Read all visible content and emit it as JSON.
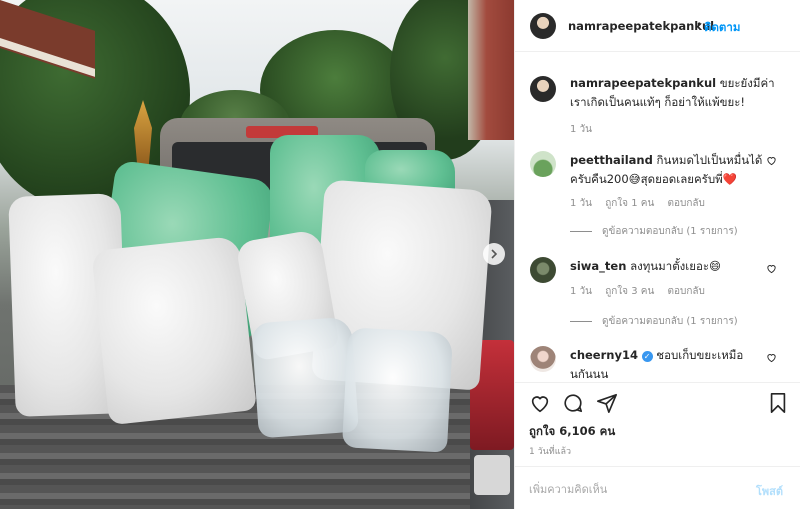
{
  "post": {
    "username": "namrapeepatekpankul",
    "follow_label": "ติดตาม",
    "separator": "•",
    "caption": "ขยะยังมีค่า เราเกิดเป็นคนแท้ๆ ก็อย่าให้แพ้ขยะ!",
    "caption_time": "1 วัน",
    "likes": "ถูกใจ 6,106 คน",
    "posted": "1 วันที่แล้ว"
  },
  "comments": [
    {
      "username": "peetthailand",
      "text": "กินหมดไปเป็นหมื่นได้ครับคืน200😅สุดยอดเลยครับพี่❤️",
      "time": "1 วัน",
      "likes": "ถูกใจ 1 คน",
      "reply": "ตอบกลับ",
      "view_replies": "ดูข้อความตอบกลับ (1 รายการ)"
    },
    {
      "username": "siwa_ten",
      "text": "ลงทุนมาตั้งเยอะ😄",
      "time": "1 วัน",
      "likes": "ถูกใจ 3 คน",
      "reply": "ตอบกลับ",
      "view_replies": "ดูข้อความตอบกลับ (1 รายการ)"
    },
    {
      "username": "cheerny14",
      "verified": "✓",
      "text": "ชอบเก็บขยะเหมือนกันนน"
    }
  ],
  "comment_box": {
    "placeholder": "เพิ่มความคิดเห็น",
    "post_label": "โพสต์"
  },
  "icons": {
    "heart": "heart-icon",
    "comment": "comment-icon",
    "share": "share-icon",
    "save": "bookmark-icon",
    "next": "chevron-right-icon"
  },
  "colors": {
    "link_blue": "#0095f6",
    "post_disabled": "#b2dffc",
    "muted": "#8e8e8e",
    "verified": "#3897f0"
  }
}
